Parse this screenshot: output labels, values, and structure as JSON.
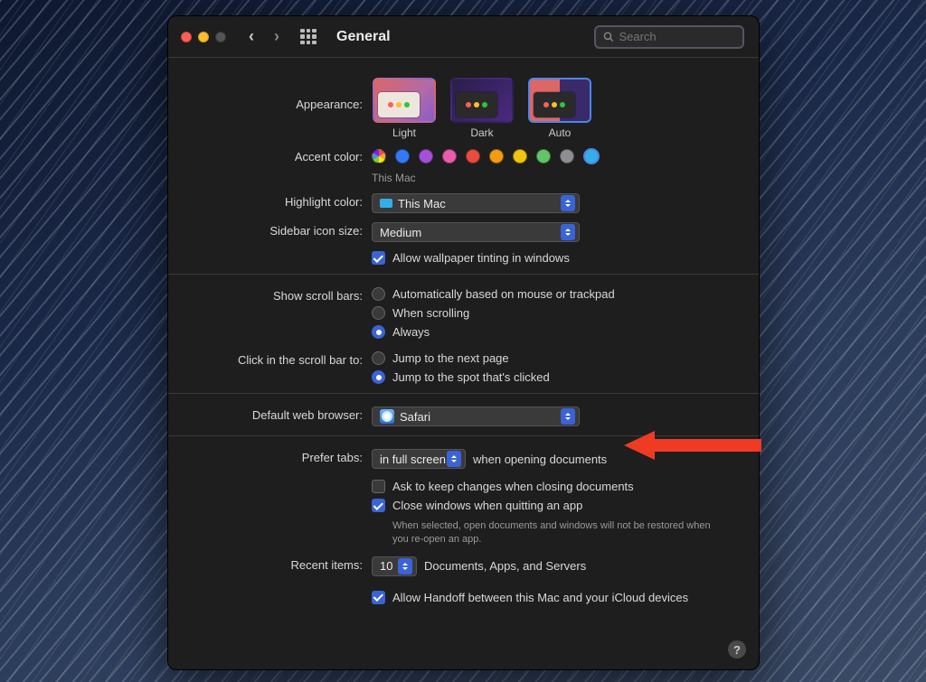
{
  "window_title": "General",
  "search_placeholder": "Search",
  "labels": {
    "appearance": "Appearance:",
    "accent": "Accent color:",
    "highlight": "Highlight color:",
    "sidebar": "Sidebar icon size:",
    "scrollbars": "Show scroll bars:",
    "click": "Click in the scroll bar to:",
    "browser": "Default web browser:",
    "tabs": "Prefer tabs:",
    "recent": "Recent items:"
  },
  "appearance": {
    "options": [
      "Light",
      "Dark",
      "Auto"
    ],
    "selected": "Auto",
    "accent_caption": "This Mac"
  },
  "highlight_value": "This Mac",
  "sidebar_value": "Medium",
  "wallpaper_checkbox": "Allow wallpaper tinting in windows",
  "scrollbars": {
    "opt1": "Automatically based on mouse or trackpad",
    "opt2": "When scrolling",
    "opt3": "Always",
    "selected": "Always"
  },
  "click_scroll": {
    "opt1": "Jump to the next page",
    "opt2": "Jump to the spot that's clicked",
    "selected": "Jump to the spot that's clicked"
  },
  "browser_value": "Safari",
  "tabs": {
    "value": "in full screen",
    "suffix": "when opening documents",
    "ask": "Ask to keep changes when closing documents",
    "close": "Close windows when quitting an app",
    "close_hint": "When selected, open documents and windows will not be restored when you re-open an app."
  },
  "recent": {
    "value": "10",
    "suffix": "Documents, Apps, and Servers",
    "handoff": "Allow Handoff between this Mac and your iCloud devices"
  },
  "help": "?"
}
